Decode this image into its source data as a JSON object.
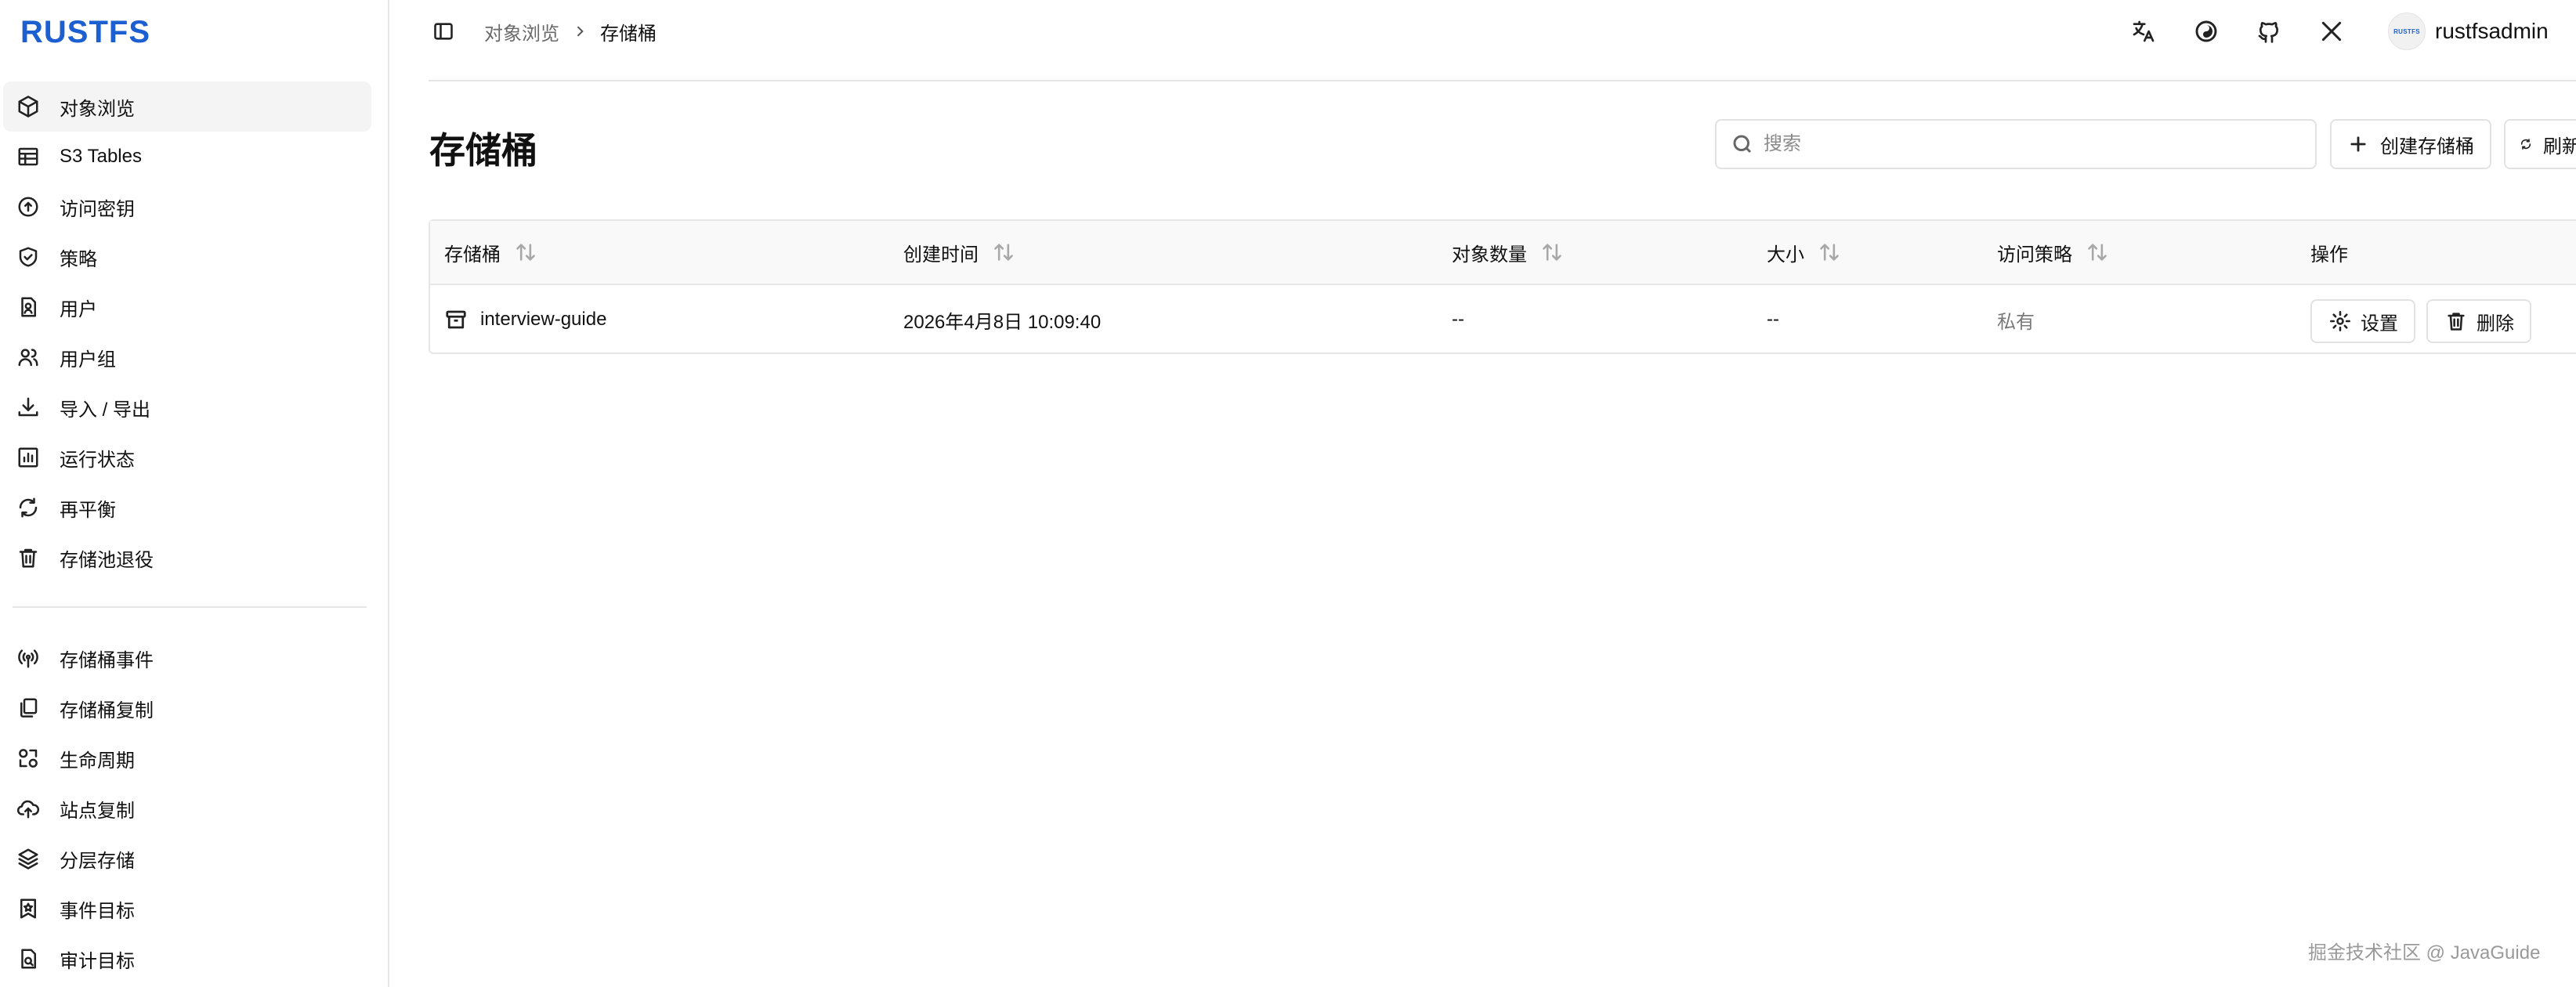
{
  "brand": {
    "logo_text": "RUSTFS",
    "logo_color": "#1b5fd1"
  },
  "sidebar": {
    "items": [
      {
        "label": "对象浏览",
        "icon": "cube-icon",
        "active": true
      },
      {
        "label": "S3 Tables",
        "icon": "table-icon"
      },
      {
        "label": "访问密钥",
        "icon": "key-circle-icon"
      },
      {
        "label": "策略",
        "icon": "shield-check-icon"
      },
      {
        "label": "用户",
        "icon": "user-file-icon"
      },
      {
        "label": "用户组",
        "icon": "users-icon"
      },
      {
        "label": "导入 / 导出",
        "icon": "download-icon"
      },
      {
        "label": "运行状态",
        "icon": "bar-chart-icon"
      },
      {
        "label": "再平衡",
        "icon": "refresh-icon"
      },
      {
        "label": "存储池退役",
        "icon": "trash-icon"
      }
    ],
    "items2": [
      {
        "label": "存储桶事件",
        "icon": "broadcast-icon"
      },
      {
        "label": "存储桶复制",
        "icon": "copy-icon"
      },
      {
        "label": "生命周期",
        "icon": "lifecycle-icon"
      },
      {
        "label": "站点复制",
        "icon": "cloud-upload-icon"
      },
      {
        "label": "分层存储",
        "icon": "layers-icon"
      },
      {
        "label": "事件目标",
        "icon": "bookmark-star-icon"
      },
      {
        "label": "审计目标",
        "icon": "audit-file-icon"
      }
    ]
  },
  "header": {
    "breadcrumb": {
      "parent": "对象浏览",
      "current": "存储桶"
    },
    "icons": [
      "translate-icon",
      "theme-icon",
      "github-icon",
      "x-icon"
    ],
    "avatar_text": "RUSTFS",
    "username": "rustfsadmin"
  },
  "page": {
    "title": "存储桶",
    "search_placeholder": "搜索",
    "create_label": "创建存储桶",
    "refresh_label": "刷新"
  },
  "table": {
    "columns": [
      "存储桶",
      "创建时间",
      "对象数量",
      "大小",
      "访问策略",
      "操作"
    ],
    "rows": [
      {
        "name": "interview-guide",
        "created": "2026年4月8日 10:09:40",
        "objects": "--",
        "size": "--",
        "policy": "私有",
        "settings_label": "设置",
        "delete_label": "删除"
      }
    ]
  },
  "watermark": "掘金技术社区 @ JavaGuide"
}
